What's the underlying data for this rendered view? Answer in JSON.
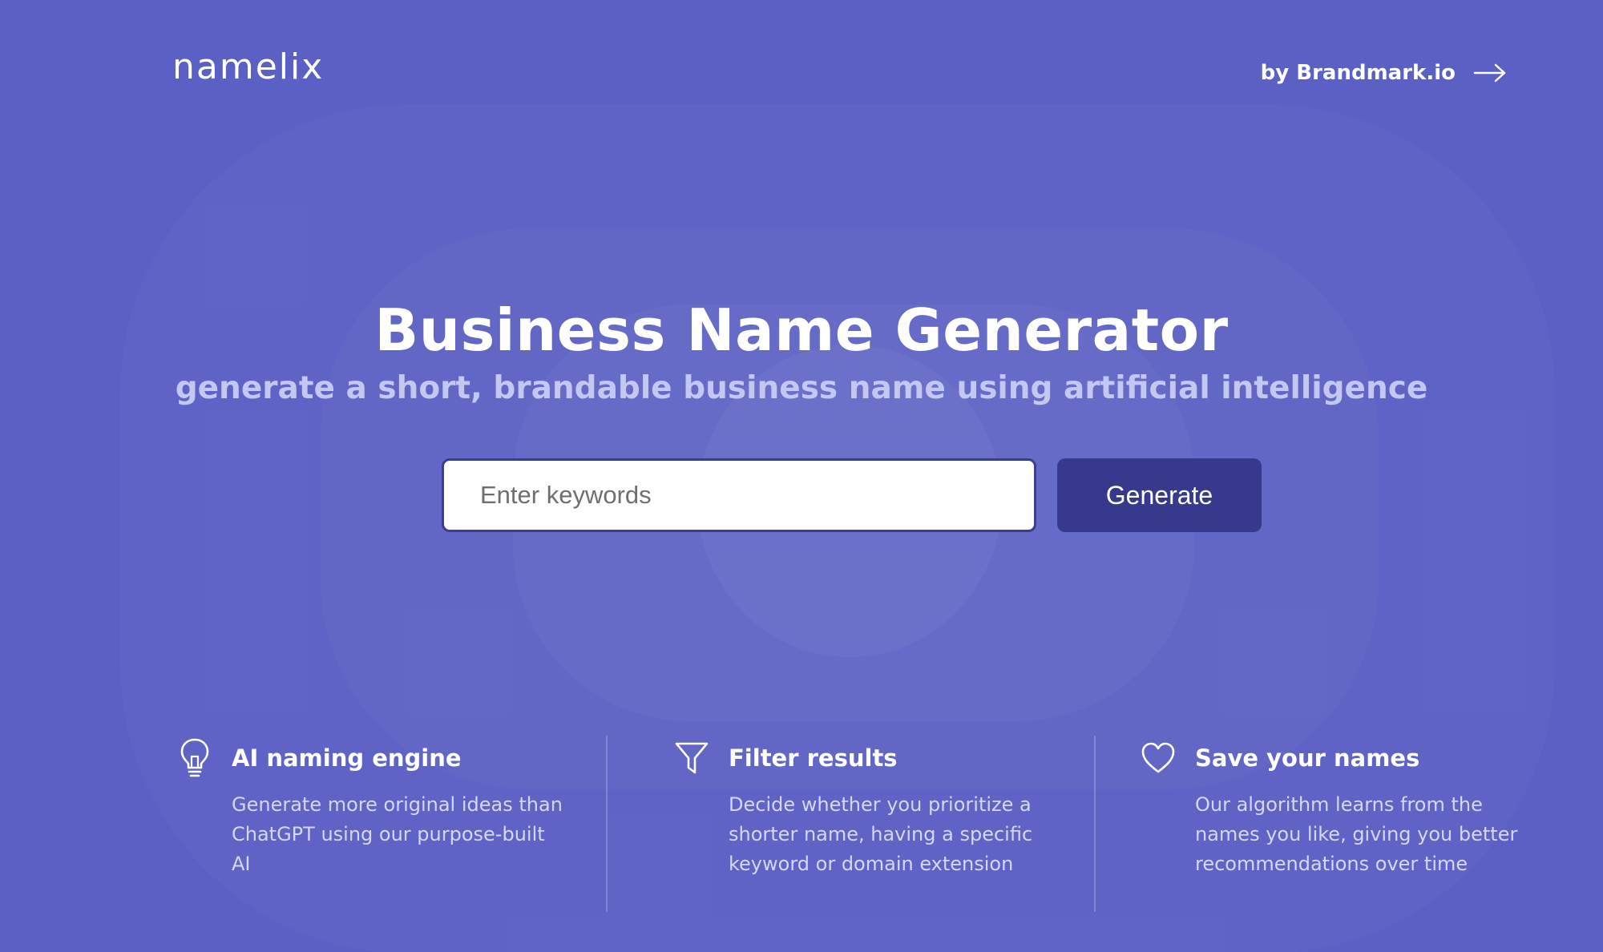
{
  "header": {
    "logo": "namelix",
    "by_link": "by Brandmark.io"
  },
  "hero": {
    "title": "Business Name Generator",
    "subtitle": "generate a short, brandable business name using artificial intelligence"
  },
  "search": {
    "placeholder": "Enter keywords",
    "value": "",
    "button_label": "Generate"
  },
  "features": [
    {
      "icon": "lightbulb-icon",
      "title": "AI naming engine",
      "description": "Generate more original ideas than ChatGPT using our purpose-built AI"
    },
    {
      "icon": "filter-icon",
      "title": "Filter results",
      "description": "Decide whether you prioritize a shorter name, having a specific keyword or domain extension"
    },
    {
      "icon": "heart-icon",
      "title": "Save your names",
      "description": "Our algorithm learns from the names you like, giving you better recommendations over time"
    }
  ],
  "colors": {
    "background": "#5b60c4",
    "button": "#373a8c",
    "subtitle": "#c3c8f2"
  }
}
